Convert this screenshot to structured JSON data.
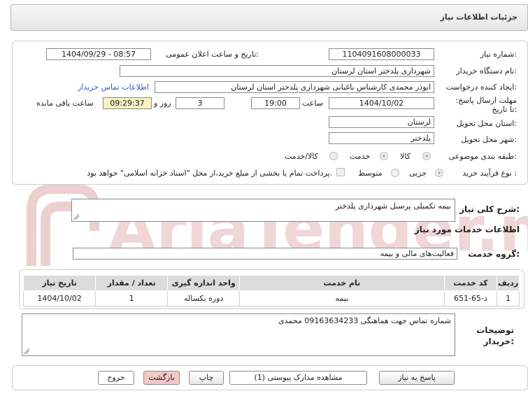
{
  "header": {
    "title": "جزئیات اطلاعات نیاز"
  },
  "form": {
    "need_number_label": "شماره نیاز:",
    "need_number": "1104091608000033",
    "announce_label": "تاریخ و ساعت اعلان عمومی:",
    "announce_value": "1404/09/29 - 08:57",
    "buyer_label": "نام دستگاه خریدار:",
    "buyer_value": "شهرداری پلدختر استان لرستان",
    "creator_label": "ایجاد کننده درخواست:",
    "creator_value": "ابوذر محمدی کارشناس باغبانی شهرداری پلدختر استان لرستان",
    "contact_link": "اطلاعات تماس خریدار",
    "deadline_label": "مهلت ارسال پاسخ: تا تاریخ:",
    "deadline_date": "1404/10/02",
    "time_label": "ساعت",
    "deadline_time": "19:00",
    "days_value": "3",
    "days_label": "روز و",
    "remaining_time": "09:29:37",
    "remaining_label": "ساعت باقی مانده",
    "province_label": "استان محل تحویل:",
    "province_value": "لرستان",
    "city_label": "شهر محل تحویل:",
    "city_value": "پلدختر",
    "category_label": "طبقه بندی موضوعی:",
    "category_options": [
      "کالا",
      "خدمت",
      "کالا/خدمت"
    ],
    "process_label": "نوع فرآیند خرید :",
    "process_options": [
      "جزیی",
      "متوسط"
    ],
    "payment_note": "پرداخت تمام یا بخشی از مبلغ خرید،از محل \"اسناد خزانه اسلامی\" خواهد بود."
  },
  "summary": {
    "label": "شرح کلی نیاز:",
    "value": "بیمه تکمیلی پرسنل شهرداری پلدختر"
  },
  "services": {
    "section_title": "اطلاعات خدمات مورد نیاز",
    "group_label": "گروه خدمت:",
    "group_value": "فعالیت‌های مالی و بیمه",
    "columns": [
      "ردیف",
      "کد خدمت",
      "نام خدمت",
      "واحد اندازه گیری",
      "تعداد / مقدار",
      "تاریخ نیاز"
    ],
    "rows": [
      [
        "1",
        "ذ-65-651",
        "بیمه",
        "دوره یکساله",
        "1",
        "1404/10/02"
      ]
    ]
  },
  "buyer_notes": {
    "label": "توضیحات خریدار:",
    "value": "شماره تماس جهت هماهنگی 09163634233 محمدی"
  },
  "buttons": {
    "reply": "پاسخ به نیاز",
    "attachments": "مشاهده مدارک پیوستی (1)",
    "print": "چاپ",
    "back": "بازگشت",
    "exit": "خروج"
  },
  "watermark": {
    "text": "AriaTender.neT"
  },
  "colors": {
    "watermark": "#e9c8c8",
    "link": "#2a5bc4",
    "highlight": "#f7f2c2",
    "button_pink": "#f4c8c8"
  }
}
